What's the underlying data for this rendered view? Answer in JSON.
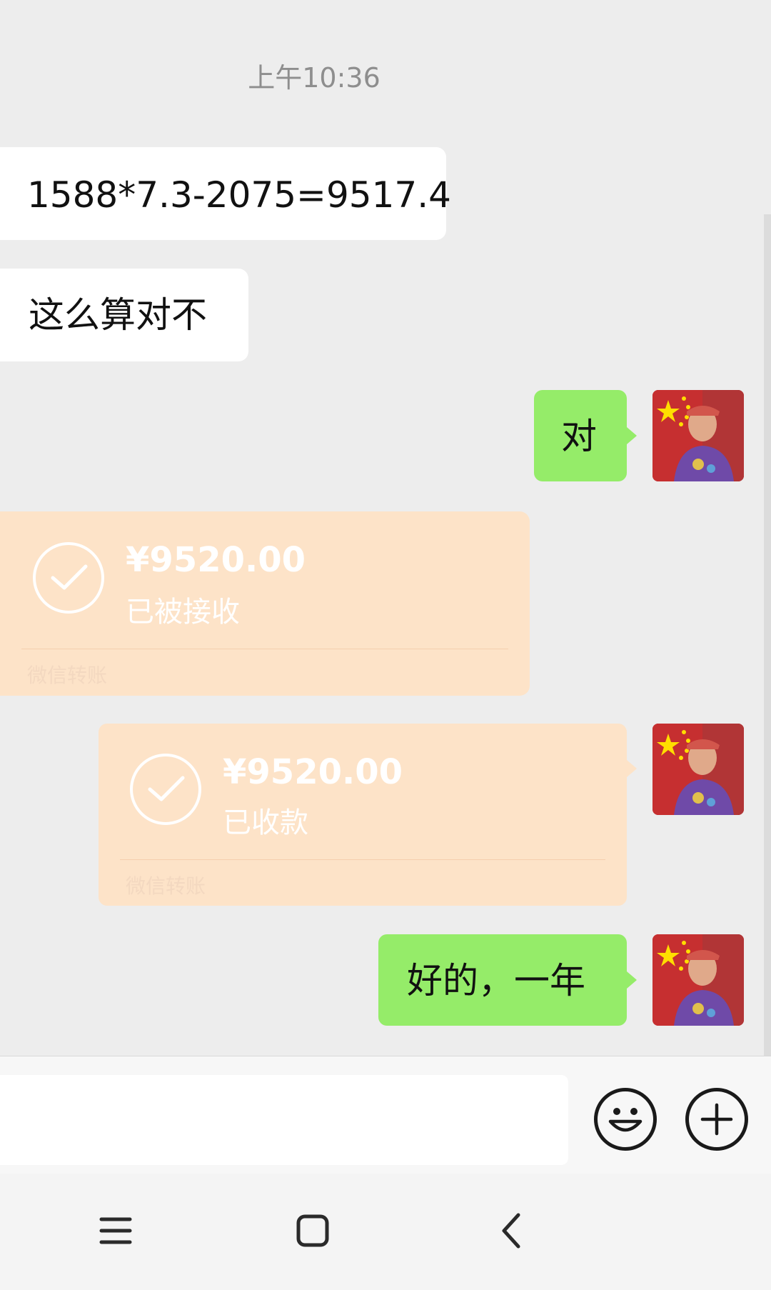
{
  "chat": {
    "timestamp": "上午10:36",
    "messages": [
      {
        "side": "left",
        "text": "1588*7.3-2075=9517.4"
      },
      {
        "side": "left",
        "text": "这么算对不"
      },
      {
        "side": "right",
        "text": "对"
      },
      {
        "side": "left",
        "type": "transfer",
        "amount": "¥9520.00",
        "status": "已被接收",
        "footer": "微信转账"
      },
      {
        "side": "right",
        "type": "transfer",
        "amount": "¥9520.00",
        "status": "已收款",
        "footer": "微信转账"
      },
      {
        "side": "right",
        "text": "好的，一年"
      }
    ]
  },
  "input": {
    "value": "",
    "placeholder": ""
  },
  "icons": {
    "emoji": "emoji-smile-icon",
    "plus": "plus-circle-icon",
    "menu": "menu-icon",
    "home": "home-square-icon",
    "back": "back-chevron-icon"
  },
  "colors": {
    "background": "#ededed",
    "bubble_left": "#ffffff",
    "bubble_right": "#95ec69",
    "transfer": "#fde3c8"
  }
}
